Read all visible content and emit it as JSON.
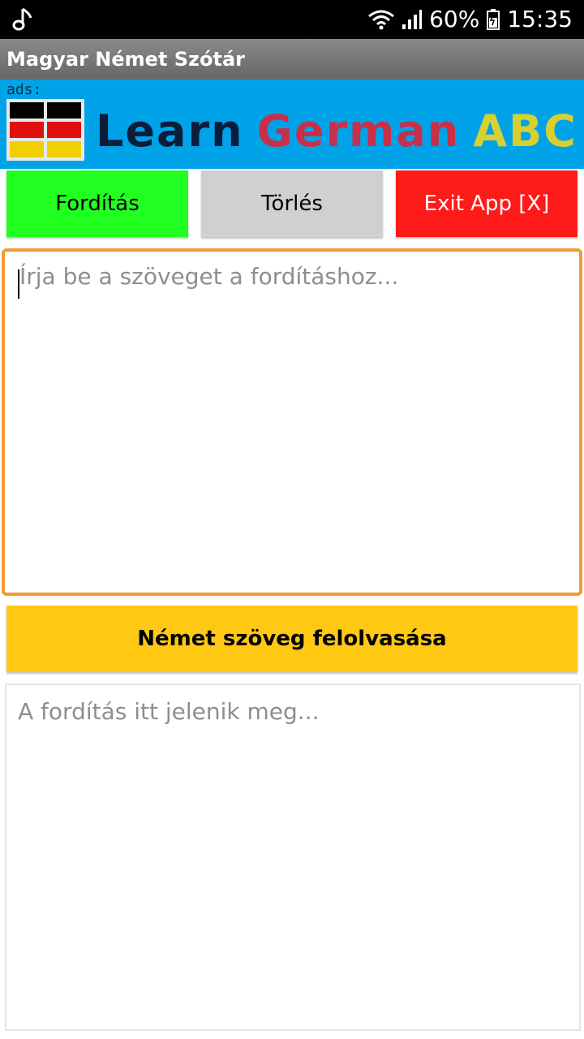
{
  "status_bar": {
    "battery": "60%",
    "time": "15:35",
    "icons": [
      "music-note-icon",
      "wifi-icon",
      "signal-icon",
      "battery-icon"
    ]
  },
  "app_bar": {
    "title": "Magyar Német Szótár"
  },
  "ad_banner": {
    "label": "ads:",
    "words": [
      {
        "text": "Learn",
        "color": "#0b1d3a"
      },
      {
        "text": "German",
        "color": "#c8304a"
      },
      {
        "text": "ABC",
        "color": "#d8d030"
      }
    ],
    "flag_colors": [
      "#000000",
      "#e01010",
      "#f0d000"
    ]
  },
  "buttons": {
    "translate_label": "Fordítás",
    "clear_label": "Törlés",
    "exit_label": "Exit App [X]"
  },
  "input": {
    "placeholder": "Írja be a szöveget a fordításhoz...",
    "value": ""
  },
  "speak_button": {
    "label": "Német szöveg felolvasása"
  },
  "output": {
    "placeholder": "A fordítás itt jelenik meg..."
  },
  "colors": {
    "translate_bg": "#20ff20",
    "clear_bg": "#d0d0d0",
    "exit_bg": "#ff1a1a",
    "speak_bg": "#ffc813",
    "input_border": "#f49b34",
    "ad_bg": "#00a2e8"
  }
}
